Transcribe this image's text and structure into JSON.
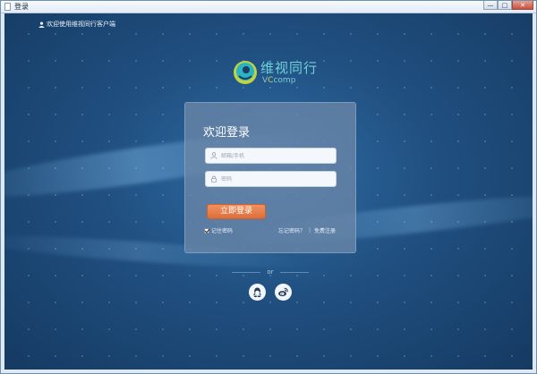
{
  "window": {
    "title": "登录",
    "buttons": {
      "minimize": "—",
      "maximize": "□",
      "close": "✕"
    }
  },
  "header": {
    "welcome_text": "欢迎使用维视同行客户端",
    "user_icon": "user-icon"
  },
  "logo": {
    "cn": "维视同行",
    "en_prefix": "V",
    "en_c": "C",
    "en_suffix": "comp",
    "icon": "vccomp-logo-icon"
  },
  "login": {
    "title": "欢迎登录",
    "username": {
      "placeholder": "邮箱/手机",
      "value": "",
      "icon": "user-icon"
    },
    "password": {
      "placeholder": "密码",
      "value": "",
      "icon": "lock-icon"
    },
    "submit_label": "立即登录",
    "remember_label": "记住密码",
    "remember_checked": true,
    "forgot_label": "忘记密码？",
    "separator": "|",
    "register_label": "免费注册"
  },
  "social": {
    "or_text": "or",
    "items": [
      {
        "name": "qq",
        "icon": "qq-icon"
      },
      {
        "name": "weibo",
        "icon": "weibo-icon"
      }
    ]
  },
  "colors": {
    "accent_button": "#e57a45",
    "logo_text": "#6ed1d8",
    "background": "#204f80"
  }
}
